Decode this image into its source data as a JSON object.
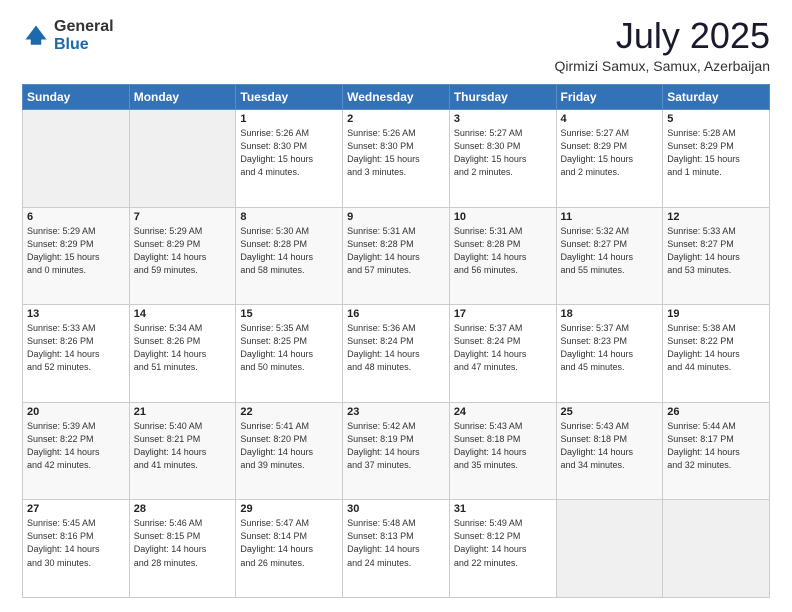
{
  "header": {
    "logo_general": "General",
    "logo_blue": "Blue",
    "month_title": "July 2025",
    "location": "Qirmizi Samux, Samux, Azerbaijan"
  },
  "calendar": {
    "days_of_week": [
      "Sunday",
      "Monday",
      "Tuesday",
      "Wednesday",
      "Thursday",
      "Friday",
      "Saturday"
    ],
    "weeks": [
      [
        {
          "day": "",
          "info": ""
        },
        {
          "day": "",
          "info": ""
        },
        {
          "day": "1",
          "info": "Sunrise: 5:26 AM\nSunset: 8:30 PM\nDaylight: 15 hours\nand 4 minutes."
        },
        {
          "day": "2",
          "info": "Sunrise: 5:26 AM\nSunset: 8:30 PM\nDaylight: 15 hours\nand 3 minutes."
        },
        {
          "day": "3",
          "info": "Sunrise: 5:27 AM\nSunset: 8:30 PM\nDaylight: 15 hours\nand 2 minutes."
        },
        {
          "day": "4",
          "info": "Sunrise: 5:27 AM\nSunset: 8:29 PM\nDaylight: 15 hours\nand 2 minutes."
        },
        {
          "day": "5",
          "info": "Sunrise: 5:28 AM\nSunset: 8:29 PM\nDaylight: 15 hours\nand 1 minute."
        }
      ],
      [
        {
          "day": "6",
          "info": "Sunrise: 5:29 AM\nSunset: 8:29 PM\nDaylight: 15 hours\nand 0 minutes."
        },
        {
          "day": "7",
          "info": "Sunrise: 5:29 AM\nSunset: 8:29 PM\nDaylight: 14 hours\nand 59 minutes."
        },
        {
          "day": "8",
          "info": "Sunrise: 5:30 AM\nSunset: 8:28 PM\nDaylight: 14 hours\nand 58 minutes."
        },
        {
          "day": "9",
          "info": "Sunrise: 5:31 AM\nSunset: 8:28 PM\nDaylight: 14 hours\nand 57 minutes."
        },
        {
          "day": "10",
          "info": "Sunrise: 5:31 AM\nSunset: 8:28 PM\nDaylight: 14 hours\nand 56 minutes."
        },
        {
          "day": "11",
          "info": "Sunrise: 5:32 AM\nSunset: 8:27 PM\nDaylight: 14 hours\nand 55 minutes."
        },
        {
          "day": "12",
          "info": "Sunrise: 5:33 AM\nSunset: 8:27 PM\nDaylight: 14 hours\nand 53 minutes."
        }
      ],
      [
        {
          "day": "13",
          "info": "Sunrise: 5:33 AM\nSunset: 8:26 PM\nDaylight: 14 hours\nand 52 minutes."
        },
        {
          "day": "14",
          "info": "Sunrise: 5:34 AM\nSunset: 8:26 PM\nDaylight: 14 hours\nand 51 minutes."
        },
        {
          "day": "15",
          "info": "Sunrise: 5:35 AM\nSunset: 8:25 PM\nDaylight: 14 hours\nand 50 minutes."
        },
        {
          "day": "16",
          "info": "Sunrise: 5:36 AM\nSunset: 8:24 PM\nDaylight: 14 hours\nand 48 minutes."
        },
        {
          "day": "17",
          "info": "Sunrise: 5:37 AM\nSunset: 8:24 PM\nDaylight: 14 hours\nand 47 minutes."
        },
        {
          "day": "18",
          "info": "Sunrise: 5:37 AM\nSunset: 8:23 PM\nDaylight: 14 hours\nand 45 minutes."
        },
        {
          "day": "19",
          "info": "Sunrise: 5:38 AM\nSunset: 8:22 PM\nDaylight: 14 hours\nand 44 minutes."
        }
      ],
      [
        {
          "day": "20",
          "info": "Sunrise: 5:39 AM\nSunset: 8:22 PM\nDaylight: 14 hours\nand 42 minutes."
        },
        {
          "day": "21",
          "info": "Sunrise: 5:40 AM\nSunset: 8:21 PM\nDaylight: 14 hours\nand 41 minutes."
        },
        {
          "day": "22",
          "info": "Sunrise: 5:41 AM\nSunset: 8:20 PM\nDaylight: 14 hours\nand 39 minutes."
        },
        {
          "day": "23",
          "info": "Sunrise: 5:42 AM\nSunset: 8:19 PM\nDaylight: 14 hours\nand 37 minutes."
        },
        {
          "day": "24",
          "info": "Sunrise: 5:43 AM\nSunset: 8:18 PM\nDaylight: 14 hours\nand 35 minutes."
        },
        {
          "day": "25",
          "info": "Sunrise: 5:43 AM\nSunset: 8:18 PM\nDaylight: 14 hours\nand 34 minutes."
        },
        {
          "day": "26",
          "info": "Sunrise: 5:44 AM\nSunset: 8:17 PM\nDaylight: 14 hours\nand 32 minutes."
        }
      ],
      [
        {
          "day": "27",
          "info": "Sunrise: 5:45 AM\nSunset: 8:16 PM\nDaylight: 14 hours\nand 30 minutes."
        },
        {
          "day": "28",
          "info": "Sunrise: 5:46 AM\nSunset: 8:15 PM\nDaylight: 14 hours\nand 28 minutes."
        },
        {
          "day": "29",
          "info": "Sunrise: 5:47 AM\nSunset: 8:14 PM\nDaylight: 14 hours\nand 26 minutes."
        },
        {
          "day": "30",
          "info": "Sunrise: 5:48 AM\nSunset: 8:13 PM\nDaylight: 14 hours\nand 24 minutes."
        },
        {
          "day": "31",
          "info": "Sunrise: 5:49 AM\nSunset: 8:12 PM\nDaylight: 14 hours\nand 22 minutes."
        },
        {
          "day": "",
          "info": ""
        },
        {
          "day": "",
          "info": ""
        }
      ]
    ]
  }
}
